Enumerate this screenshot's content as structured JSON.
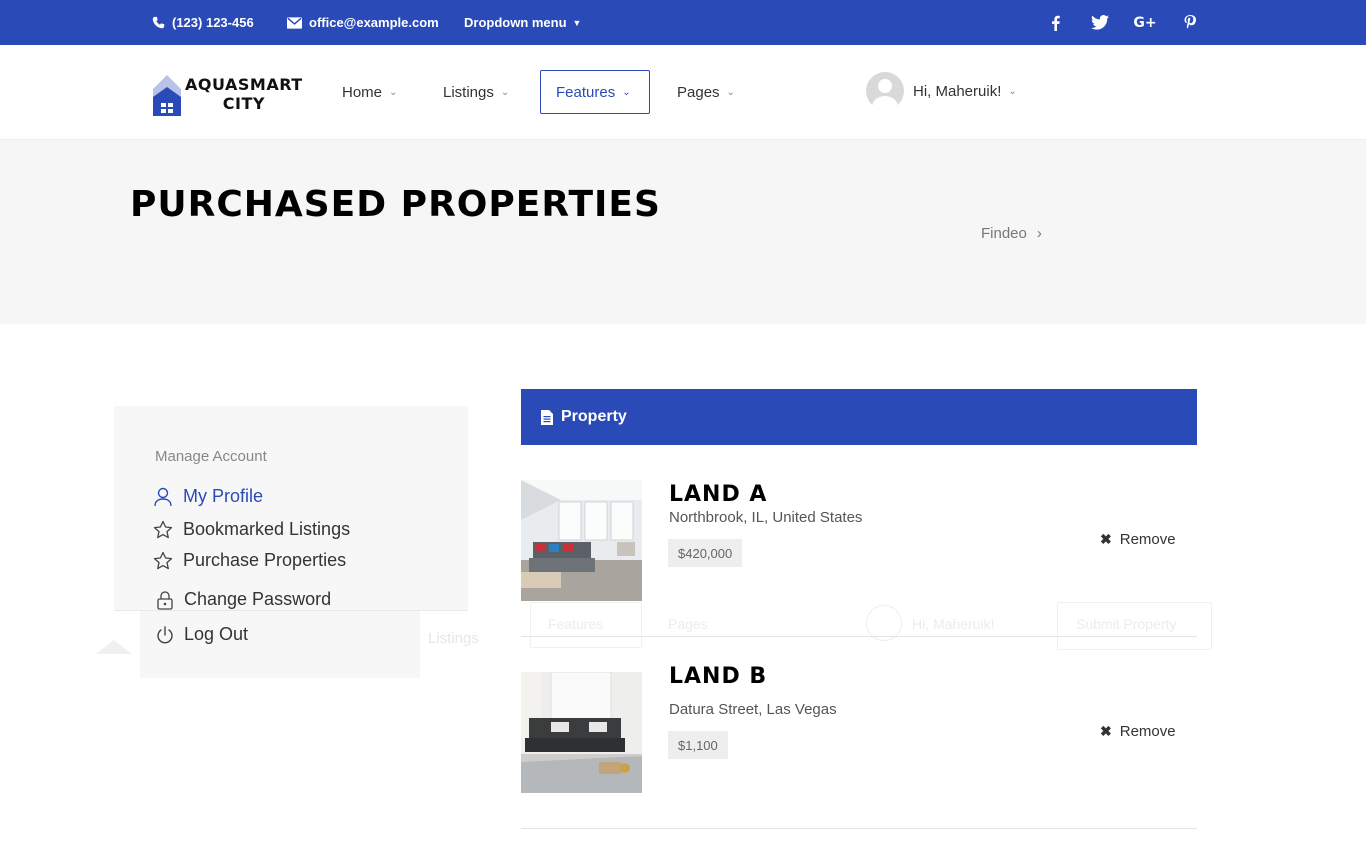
{
  "topbar": {
    "phone": "(123) 123-456",
    "email": "office@example.com",
    "dropdown": "Dropdown menu",
    "social_icons": [
      "facebook-icon",
      "twitter-icon",
      "google-plus-icon",
      "pinterest-icon"
    ],
    "social_glyphs": [
      "f",
      "🐦",
      "G+",
      "P"
    ]
  },
  "header": {
    "logo_line1": "AQUASMART",
    "logo_line2": "CITY",
    "nav": [
      "Home",
      "Listings",
      "Features",
      "Pages"
    ],
    "active_nav": "Features",
    "user_greeting": "Hi, Maheruik!"
  },
  "title": {
    "text": "PURCHASED PROPERTIES",
    "breadcrumb": "Findeo",
    "breadcrumb_sep": "›"
  },
  "sidebar": {
    "heading": "Manage Account",
    "links": [
      "My Profile",
      "Bookmarked Listings",
      "Purchase Properties",
      "Change Password",
      "Log Out"
    ],
    "active_link": "My Profile"
  },
  "properties": {
    "header": "Property",
    "remove_label": "Remove",
    "items": [
      {
        "name": "LAND A",
        "address": "Northbrook, IL, United States",
        "price": "$420,000"
      },
      {
        "name": "LAND B",
        "address": "Datura Street, Las Vegas",
        "price": "$1,100"
      }
    ]
  },
  "ghost_overlay": {
    "listings": "Listings",
    "features": "Features",
    "pages": "Pages",
    "user": "Hi, Maheruik!",
    "submit": "Submit Property"
  },
  "colors": {
    "accent": "#2a4ab8",
    "title_band": "#f6f6f6",
    "sidebar_bg": "#f7f7f7"
  }
}
